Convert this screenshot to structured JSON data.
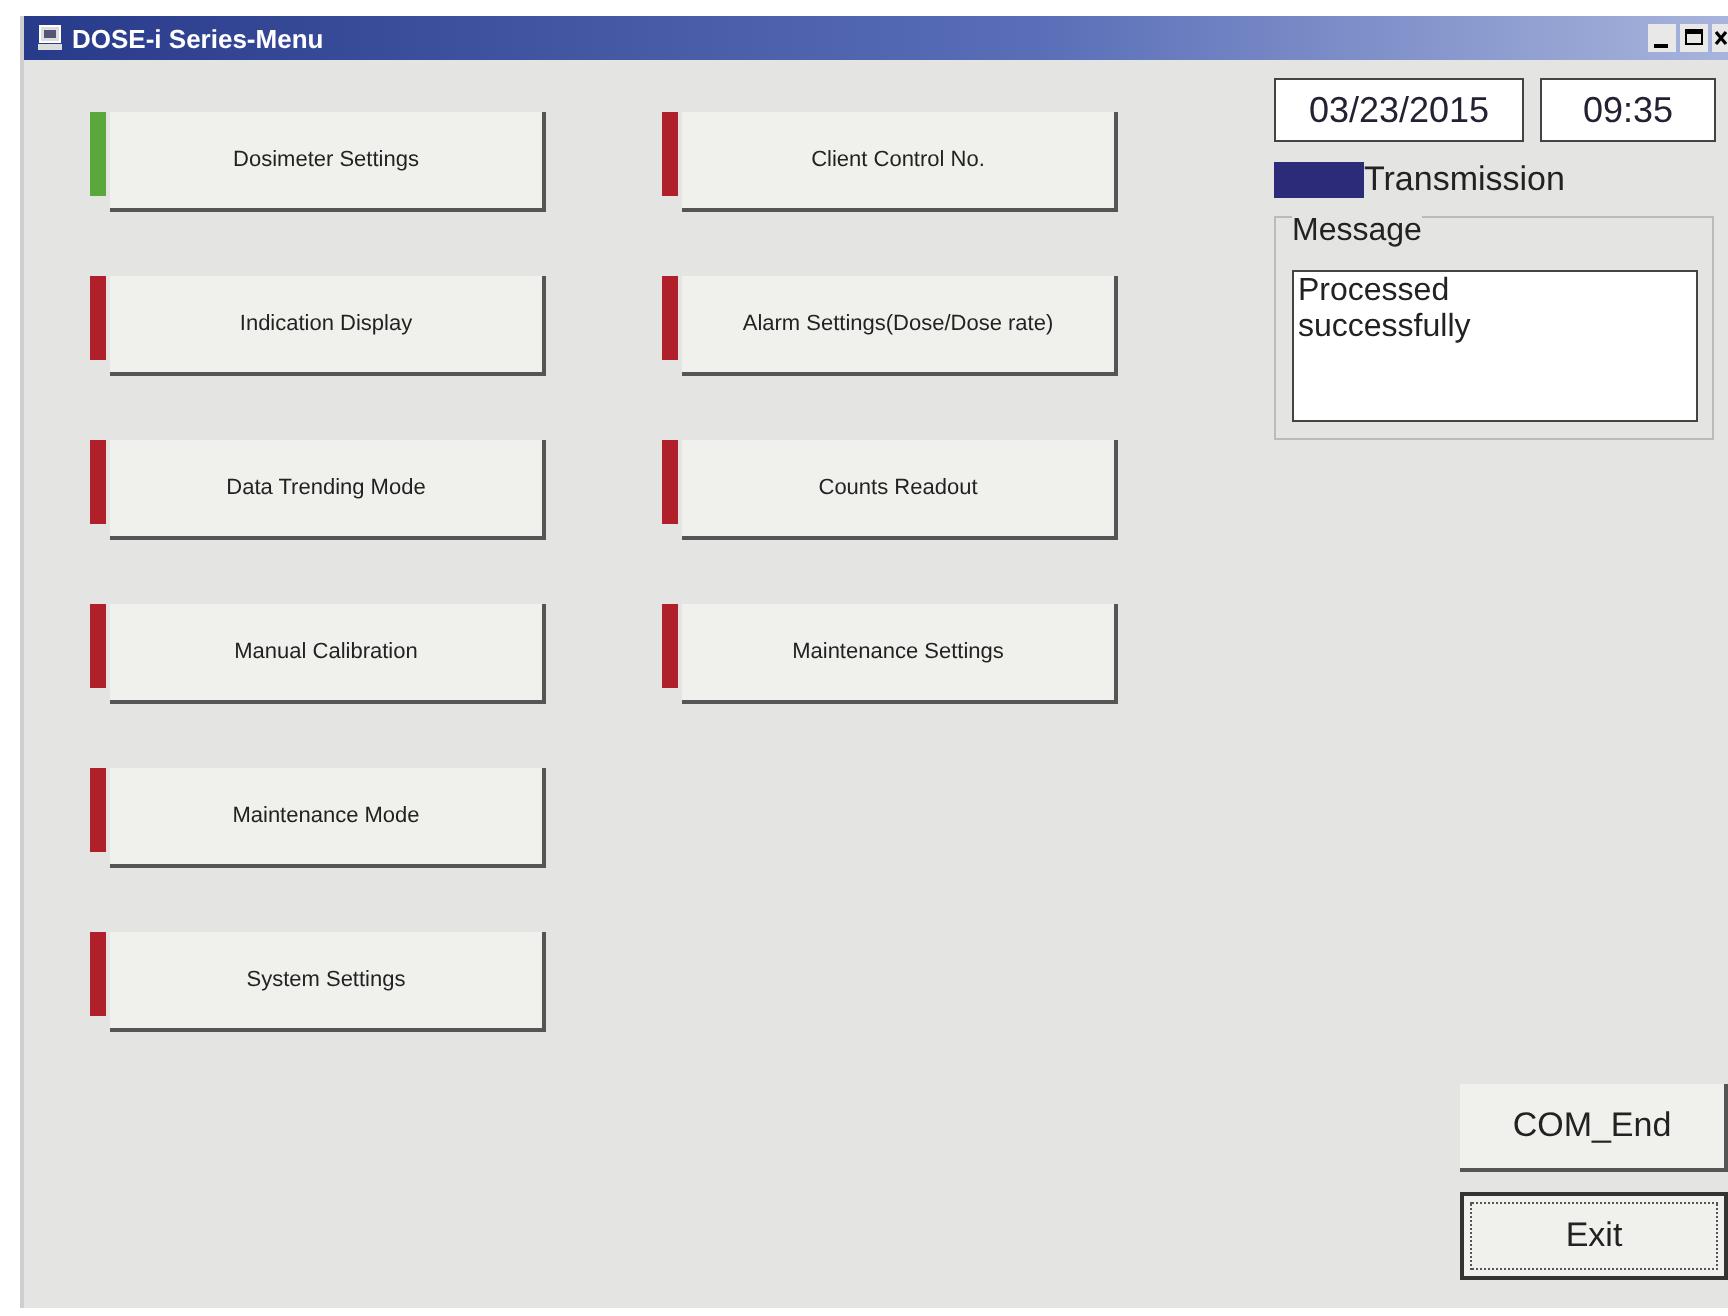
{
  "window": {
    "title": "DOSE-i Series-Menu"
  },
  "menu_columns": [
    {
      "buttons": [
        {
          "label": "Dosimeter Settings",
          "color": "#5aa83c"
        },
        {
          "label": "Indication Display",
          "color": "#b0202a"
        },
        {
          "label": "Data Trending Mode",
          "color": "#b0202a"
        },
        {
          "label": "Manual Calibration",
          "color": "#b0202a"
        },
        {
          "label": "Maintenance Mode",
          "color": "#b0202a"
        },
        {
          "label": "System Settings",
          "color": "#b0202a"
        }
      ]
    },
    {
      "buttons": [
        {
          "label": "Client Control No.",
          "color": "#b0202a"
        },
        {
          "label": "Alarm Settings(Dose/Dose rate)",
          "color": "#b0202a"
        },
        {
          "label": "Counts Readout",
          "color": "#b0202a"
        },
        {
          "label": "Maintenance Settings",
          "color": "#b0202a"
        }
      ]
    }
  ],
  "date": "03/23/2015",
  "time": "09:35",
  "transmission": {
    "label": "Transmission"
  },
  "message": {
    "title": "Message",
    "text": "Processed\nsuccessfully"
  },
  "buttons": [
    {
      "label": "COM_End",
      "focused": false
    },
    {
      "label": "Exit",
      "focused": true
    }
  ]
}
